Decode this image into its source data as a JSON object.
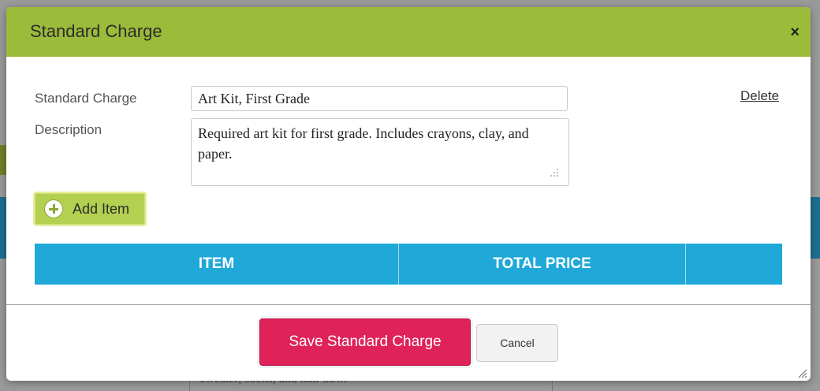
{
  "background": {
    "bottom_text": "sweater, socks, and hair bow."
  },
  "modal": {
    "title": "Standard Charge",
    "close_symbol": "×",
    "header_color": "#9bbb3a",
    "form": {
      "charge_label": "Standard Charge",
      "charge_value": "Art Kit, First Grade",
      "description_label": "Description",
      "description_value": "Required art kit for first grade. Includes crayons, clay, and paper.",
      "delete_label": "Delete"
    },
    "add_item_label": "Add Item",
    "table": {
      "columns": [
        "ITEM",
        "TOTAL PRICE",
        ""
      ],
      "header_color": "#1fa8d8"
    },
    "footer": {
      "save_label": "Save Standard Charge",
      "cancel_label": "Cancel",
      "save_color": "#e0225a"
    }
  },
  "icons": [
    "close-icon",
    "plus-icon",
    "resize-grip-icon"
  ]
}
